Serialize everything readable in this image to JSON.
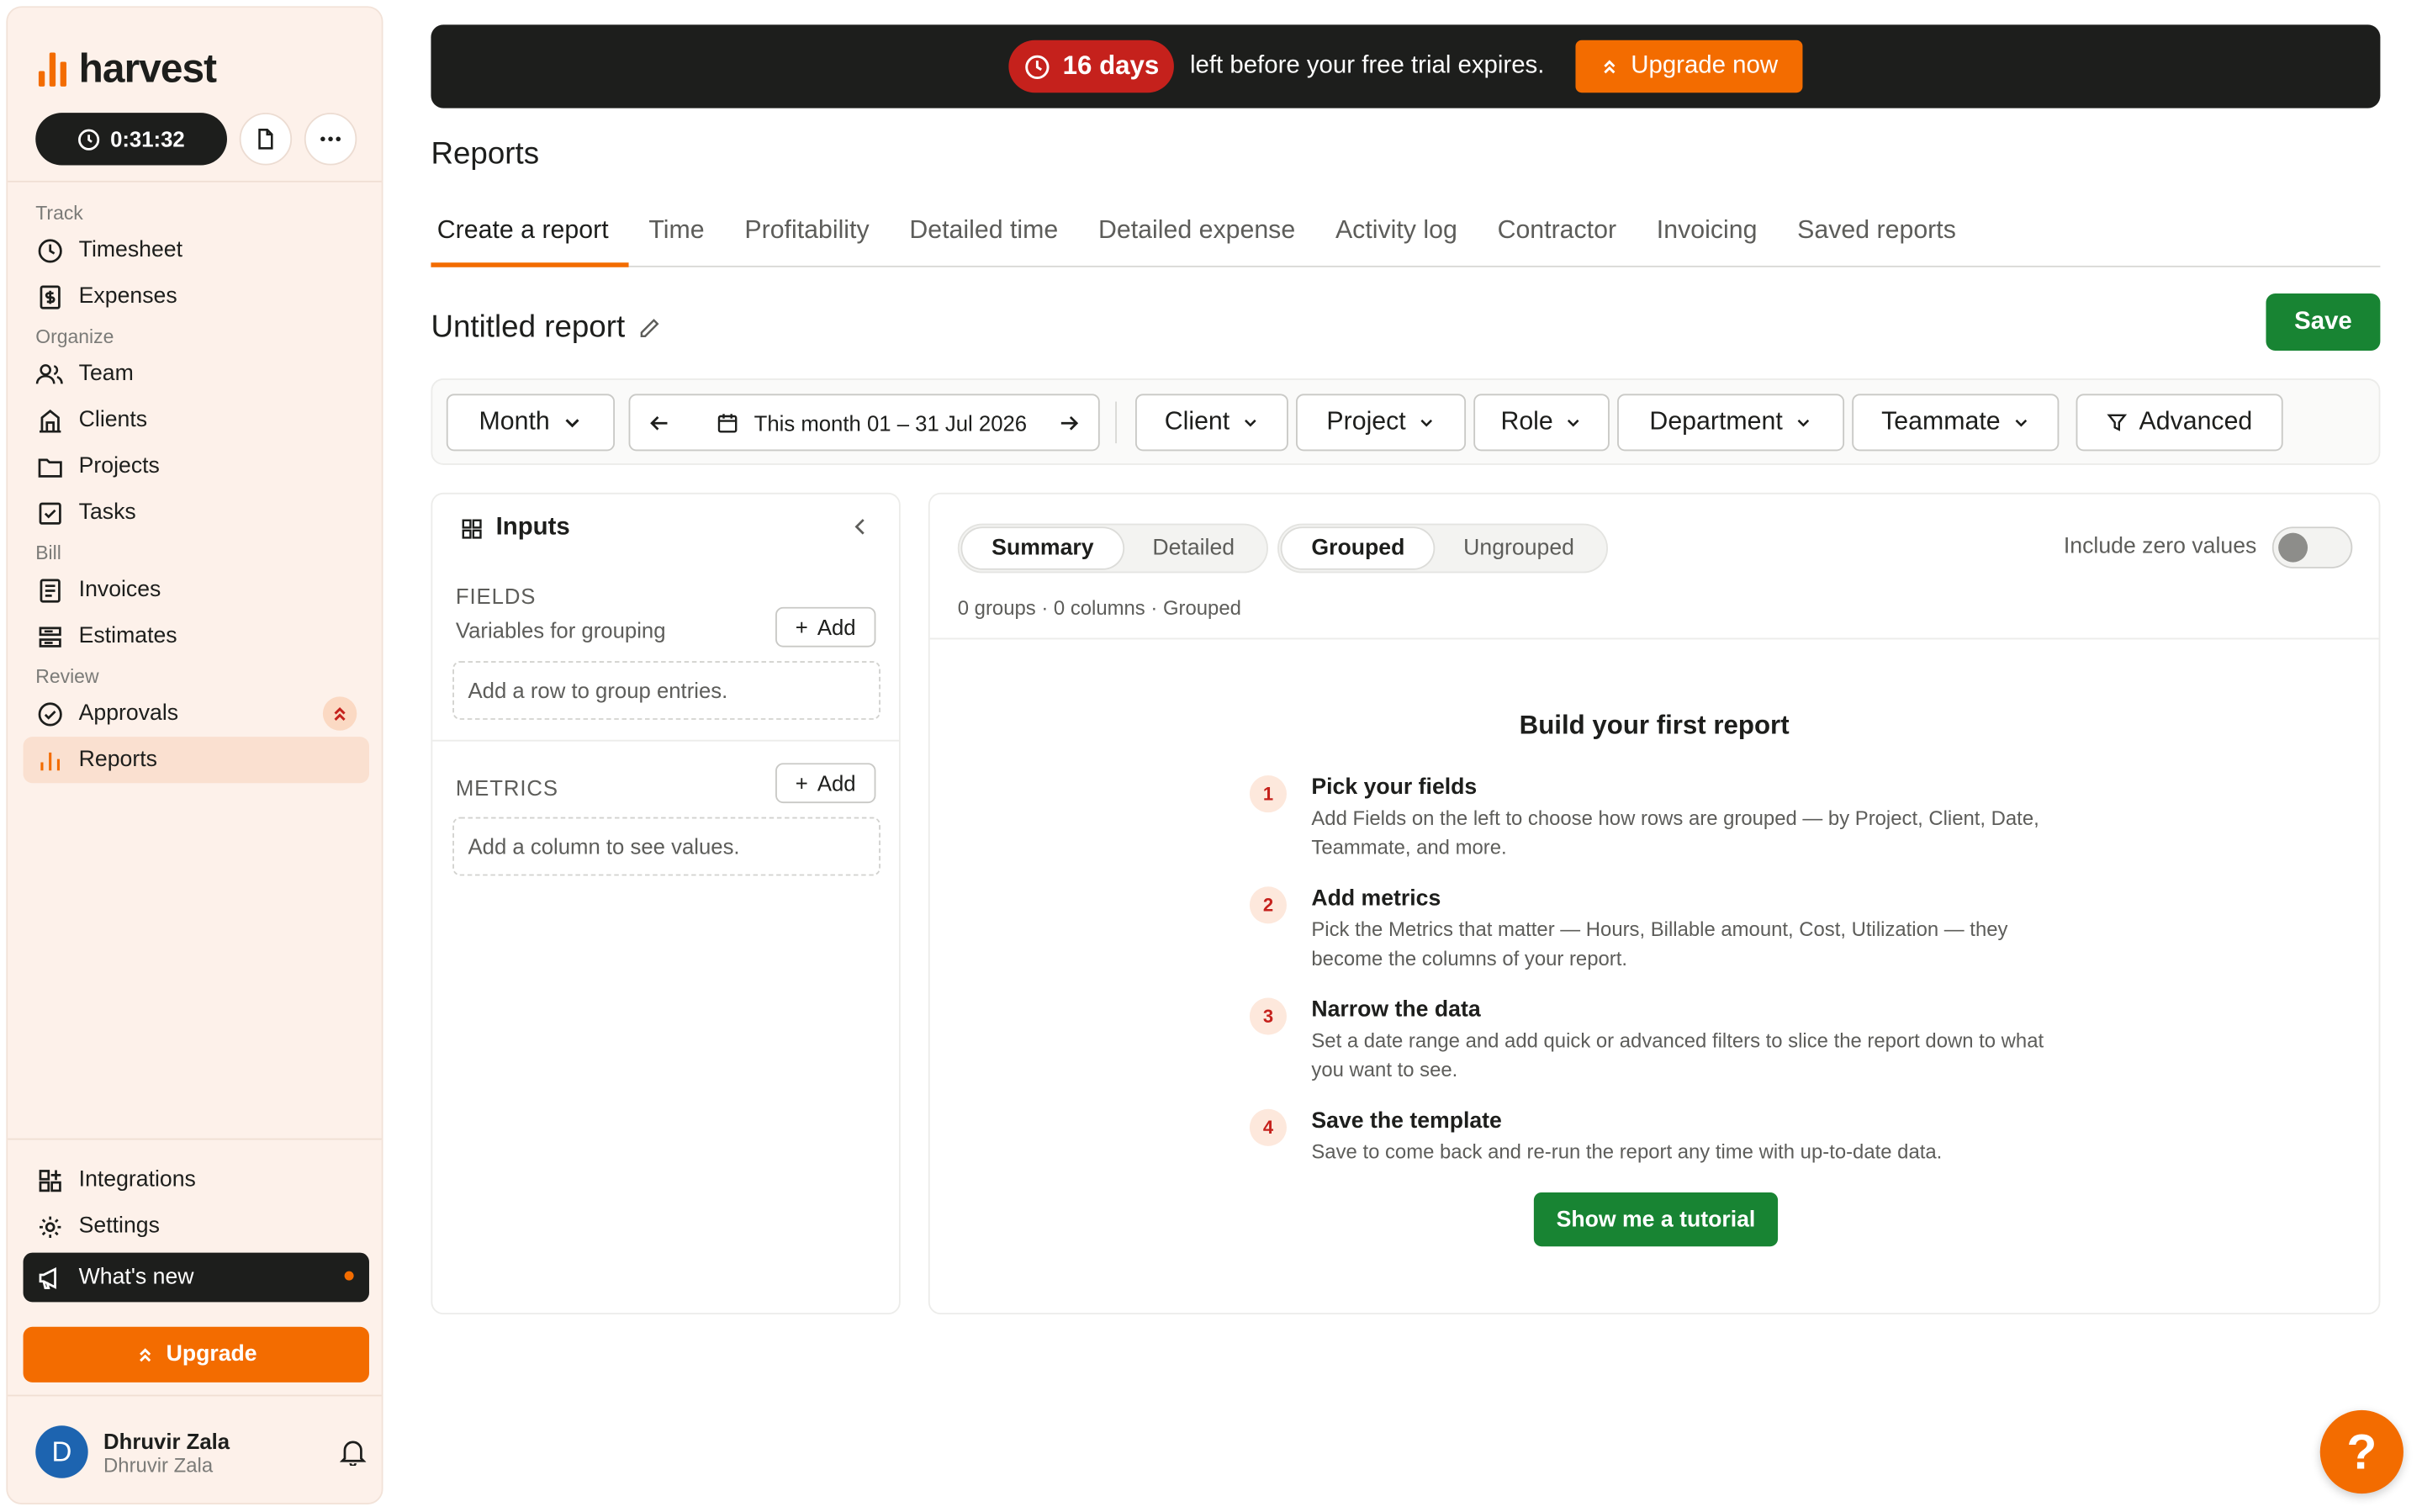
{
  "brand": {
    "name": "harvest",
    "color": "#f36c00"
  },
  "timer": {
    "value": "0:31:32"
  },
  "sidebar": {
    "groups": [
      {
        "label": "Track",
        "items": [
          {
            "label": "Timesheet",
            "icon": "clock-icon"
          },
          {
            "label": "Expenses",
            "icon": "receipt-icon"
          }
        ]
      },
      {
        "label": "Organize",
        "items": [
          {
            "label": "Team",
            "icon": "team-icon"
          },
          {
            "label": "Clients",
            "icon": "building-icon"
          },
          {
            "label": "Projects",
            "icon": "folder-icon"
          },
          {
            "label": "Tasks",
            "icon": "task-icon"
          }
        ]
      },
      {
        "label": "Bill",
        "items": [
          {
            "label": "Invoices",
            "icon": "invoice-icon"
          },
          {
            "label": "Estimates",
            "icon": "estimate-icon"
          }
        ]
      },
      {
        "label": "Review",
        "items": [
          {
            "label": "Approvals",
            "icon": "check-circle-icon"
          },
          {
            "label": "Reports",
            "icon": "bar-chart-icon"
          }
        ]
      }
    ],
    "bottom": [
      {
        "label": "Integrations",
        "icon": "integrations-icon"
      },
      {
        "label": "Settings",
        "icon": "gear-icon"
      },
      {
        "label": "What's new",
        "icon": "megaphone-icon"
      }
    ],
    "upgrade_label": "Upgrade",
    "user": {
      "name": "Dhruvir Zala",
      "sub": "Dhruvir Zala",
      "initial": "D"
    }
  },
  "trial": {
    "days": "16 days",
    "message": "left before your free trial expires.",
    "cta": "Upgrade now"
  },
  "page": {
    "title": "Reports"
  },
  "tabs": [
    "Create a report",
    "Time",
    "Profitability",
    "Detailed time",
    "Detailed expense",
    "Activity log",
    "Contractor",
    "Invoicing",
    "Saved reports"
  ],
  "report": {
    "title": "Untitled report",
    "save_label": "Save"
  },
  "filters": {
    "period": "Month",
    "range": "This month 01 – 31 Jul 2026",
    "client": "Client",
    "project": "Project",
    "role": "Role",
    "department": "Department",
    "teammate": "Teammate",
    "advanced": "Advanced"
  },
  "inputs": {
    "title": "Inputs",
    "fields_label": "FIELDS",
    "fields_sub": "Variables for grouping",
    "fields_placeholder": "Add a row to group entries.",
    "metrics_label": "METRICS",
    "metrics_placeholder": "Add a column to see values.",
    "add_label": "Add"
  },
  "view": {
    "mode_summary": "Summary",
    "mode_detailed": "Detailed",
    "group_grouped": "Grouped",
    "group_ungrouped": "Ungrouped",
    "zero_values": "Include zero values",
    "meta": "0 groups · 0 columns · Grouped"
  },
  "empty": {
    "title": "Build your first report",
    "steps": [
      {
        "n": "1",
        "title": "Pick your fields",
        "desc": "Add Fields on the left to choose how rows are grouped — by Project, Client, Date, Teammate, and more."
      },
      {
        "n": "2",
        "title": "Add metrics",
        "desc": "Pick the Metrics that matter — Hours, Billable amount, Cost, Utilization — they become the columns of your report."
      },
      {
        "n": "3",
        "title": "Narrow the data",
        "desc": "Set a date range and add quick or advanced filters to slice the report down to what you want to see."
      },
      {
        "n": "4",
        "title": "Save the template",
        "desc": "Save to come back and re-run the report any time with up-to-date data."
      }
    ],
    "cta": "Show me a tutorial"
  },
  "help": {
    "glyph": "?"
  }
}
